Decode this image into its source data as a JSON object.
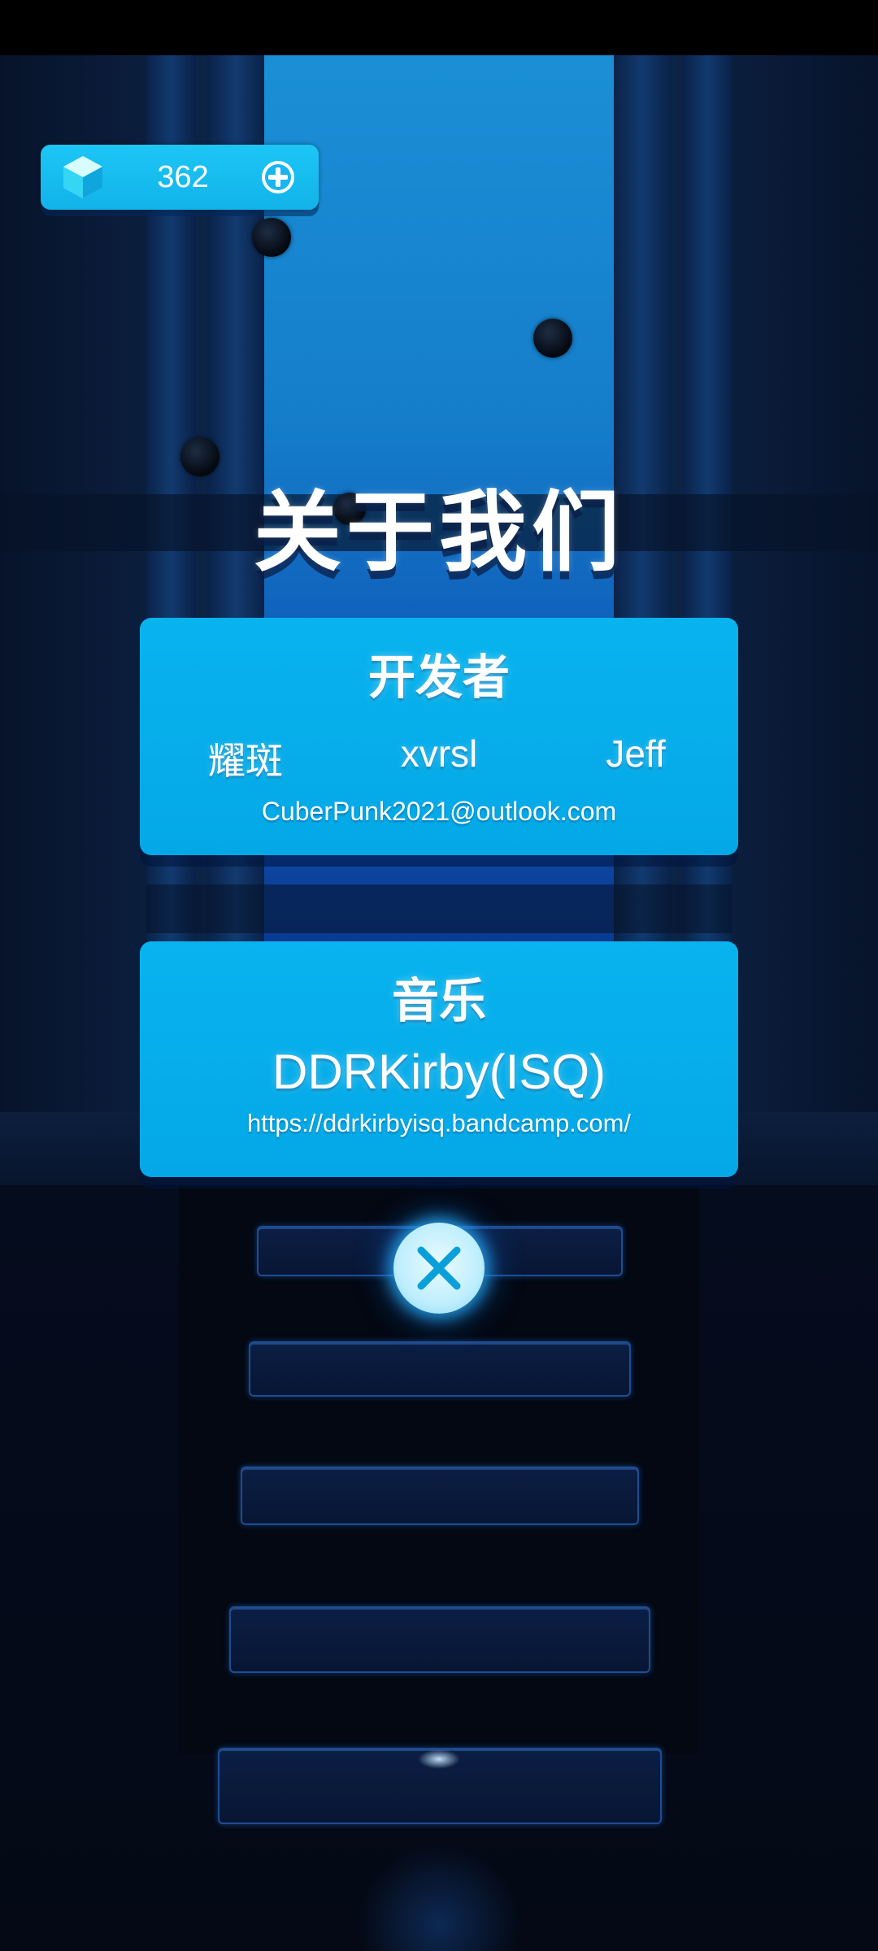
{
  "currency": {
    "amount": "362",
    "gem_icon": "gem-icon",
    "add_icon": "plus-icon"
  },
  "title": "关于我们",
  "developers": {
    "heading": "开发者",
    "names": [
      "耀斑",
      "xvrsl",
      "Jeff"
    ],
    "email": "CuberPunk2021@outlook.com"
  },
  "music": {
    "heading": "音乐",
    "artist": "DDRKirby(ISQ)",
    "url": "https://ddrkirbyisq.bandcamp.com/"
  },
  "close_button": {
    "icon": "close-icon"
  },
  "colors": {
    "card": "#04a8e6",
    "currency_pill": "#18bff2",
    "close_glow": "#28b4ff"
  }
}
